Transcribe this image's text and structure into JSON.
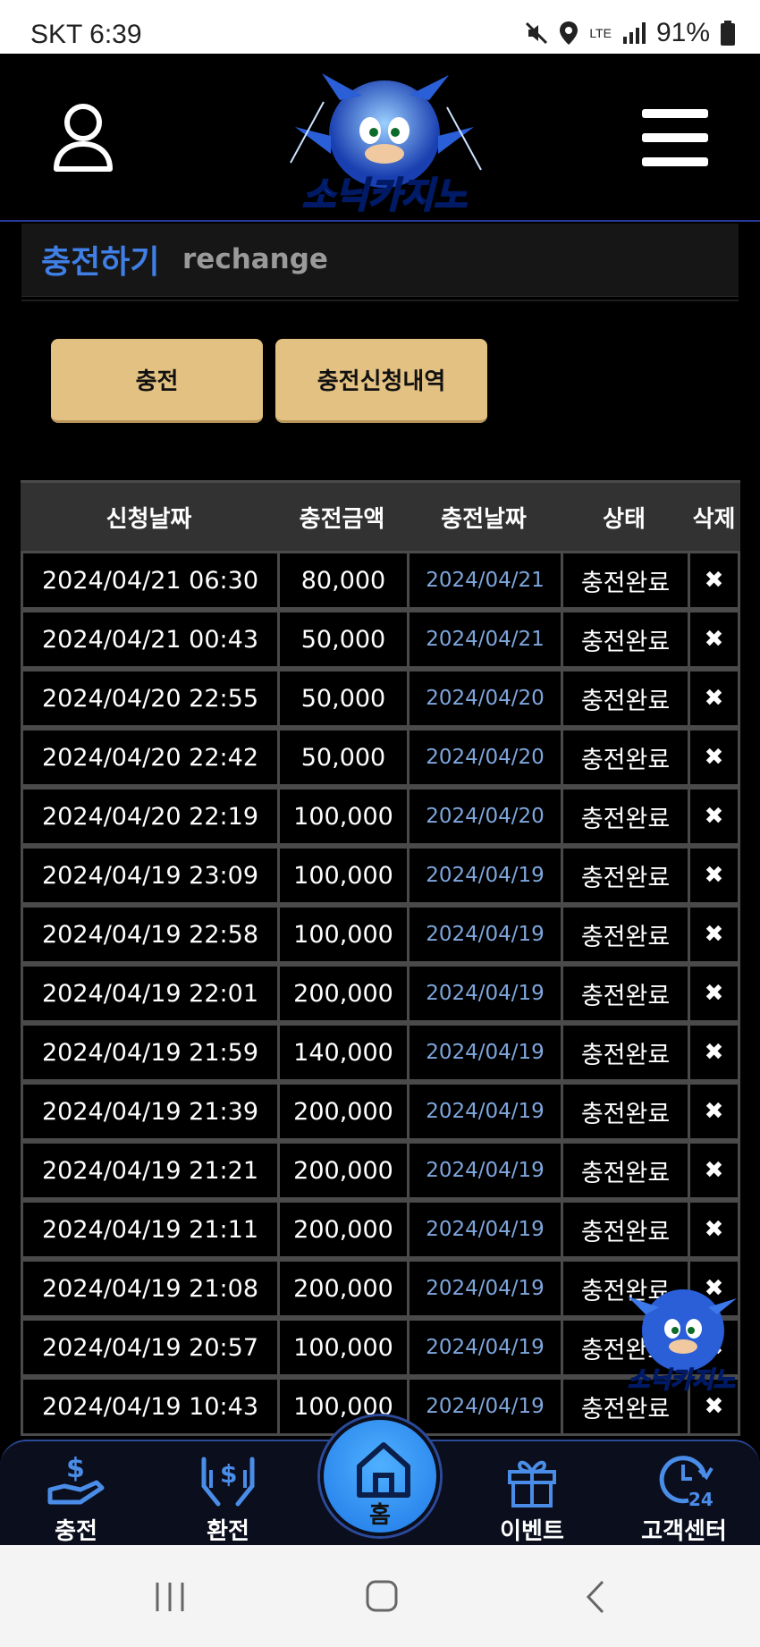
{
  "status_bar": {
    "carrier_time": "SKT 6:39",
    "network": "LTE",
    "battery": "91%"
  },
  "header": {
    "logo_text": "소닉카지노"
  },
  "page_title": {
    "ko": "충전하기",
    "en": "rechange"
  },
  "buttons": {
    "charge": "충전",
    "history": "충전신청내역"
  },
  "table": {
    "headers": [
      "신청날짜",
      "충전금액",
      "충전날짜",
      "상태",
      "삭제"
    ],
    "rows": [
      {
        "req": "2024/04/21 06:30",
        "amount": "80,000",
        "date": "2024/04/21",
        "status": "충전완료"
      },
      {
        "req": "2024/04/21 00:43",
        "amount": "50,000",
        "date": "2024/04/21",
        "status": "충전완료"
      },
      {
        "req": "2024/04/20 22:55",
        "amount": "50,000",
        "date": "2024/04/20",
        "status": "충전완료"
      },
      {
        "req": "2024/04/20 22:42",
        "amount": "50,000",
        "date": "2024/04/20",
        "status": "충전완료"
      },
      {
        "req": "2024/04/20 22:19",
        "amount": "100,000",
        "date": "2024/04/20",
        "status": "충전완료"
      },
      {
        "req": "2024/04/19 23:09",
        "amount": "100,000",
        "date": "2024/04/19",
        "status": "충전완료"
      },
      {
        "req": "2024/04/19 22:58",
        "amount": "100,000",
        "date": "2024/04/19",
        "status": "충전완료"
      },
      {
        "req": "2024/04/19 22:01",
        "amount": "200,000",
        "date": "2024/04/19",
        "status": "충전완료"
      },
      {
        "req": "2024/04/19 21:59",
        "amount": "140,000",
        "date": "2024/04/19",
        "status": "충전완료"
      },
      {
        "req": "2024/04/19 21:39",
        "amount": "200,000",
        "date": "2024/04/19",
        "status": "충전완료"
      },
      {
        "req": "2024/04/19 21:21",
        "amount": "200,000",
        "date": "2024/04/19",
        "status": "충전완료"
      },
      {
        "req": "2024/04/19 21:11",
        "amount": "200,000",
        "date": "2024/04/19",
        "status": "충전완료"
      },
      {
        "req": "2024/04/19 21:08",
        "amount": "200,000",
        "date": "2024/04/19",
        "status": "충전완료"
      },
      {
        "req": "2024/04/19 20:57",
        "amount": "100,000",
        "date": "2024/04/19",
        "status": "충전완료"
      },
      {
        "req": "2024/04/19 10:43",
        "amount": "100,000",
        "date": "2024/04/19",
        "status": "충전완료"
      }
    ],
    "delete_glyph": "✖"
  },
  "bottom_nav": {
    "charge": "충전",
    "exchange": "환전",
    "home": "홈",
    "event": "이벤트",
    "support": "고객센터"
  },
  "colors": {
    "accent_blue": "#3f7fe6",
    "button_gold": "#e3c182",
    "date_blue": "#7ea6dd"
  }
}
